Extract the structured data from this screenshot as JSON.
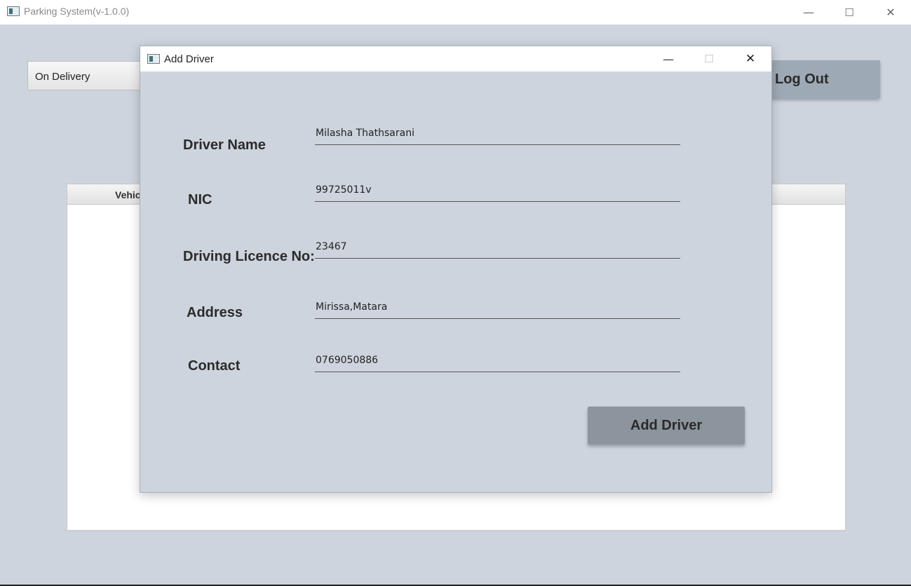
{
  "main_window": {
    "title": "Parking System(v-1.0.0)",
    "controls": {
      "minimize": "—",
      "maximize": "☐",
      "close": "✕"
    }
  },
  "background": {
    "status_combo_value": "On Delivery",
    "logout_label": "Log Out",
    "table_header_first_column": "Vehic"
  },
  "dialog": {
    "title": "Add Driver",
    "controls": {
      "minimize": "—",
      "maximize": "☐",
      "close": "✕"
    },
    "fields": {
      "driver_name": {
        "label": "Driver Name",
        "value": "Milasha Thathsarani"
      },
      "nic": {
        "label": "NIC",
        "value": "99725011v"
      },
      "licence": {
        "label": "Driving Licence No:",
        "value": "23467"
      },
      "address": {
        "label": "Address",
        "value": "Mirissa,Matara"
      },
      "contact": {
        "label": "Contact",
        "value": "0769050886"
      }
    },
    "submit_label": "Add Driver"
  }
}
